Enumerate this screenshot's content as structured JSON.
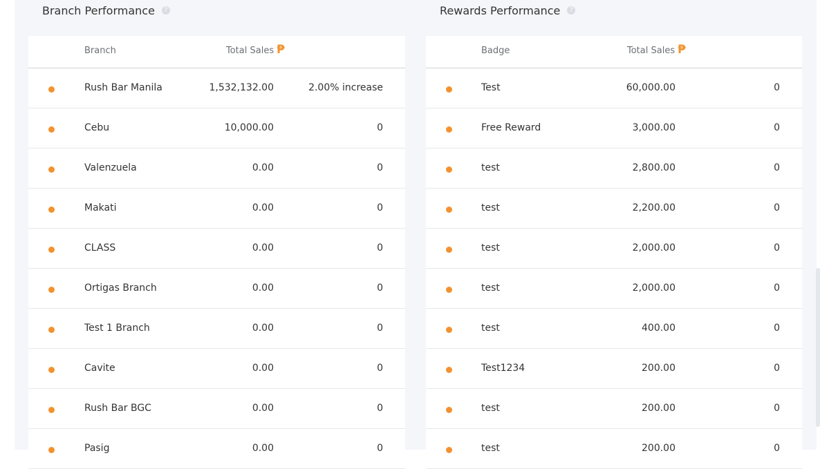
{
  "branch_performance": {
    "title": "Branch Performance",
    "col_name": "Branch",
    "col_sales": "Total Sales",
    "currency_icon": "peso-icon",
    "rows": [
      {
        "name": "Rush Bar Manila",
        "sales": "1,532,132.00",
        "change": "2.00% increase"
      },
      {
        "name": "Cebu",
        "sales": "10,000.00",
        "change": "0"
      },
      {
        "name": "Valenzuela",
        "sales": "0.00",
        "change": "0"
      },
      {
        "name": "Makati",
        "sales": "0.00",
        "change": "0"
      },
      {
        "name": "CLASS",
        "sales": "0.00",
        "change": "0"
      },
      {
        "name": "Ortigas Branch",
        "sales": "0.00",
        "change": "0"
      },
      {
        "name": "Test 1 Branch",
        "sales": "0.00",
        "change": "0"
      },
      {
        "name": "Cavite",
        "sales": "0.00",
        "change": "0"
      },
      {
        "name": "Rush Bar BGC",
        "sales": "0.00",
        "change": "0"
      },
      {
        "name": "Pasig",
        "sales": "0.00",
        "change": "0"
      }
    ]
  },
  "rewards_performance": {
    "title": "Rewards Performance",
    "col_name": "Badge",
    "col_sales": "Total Sales",
    "currency_icon": "peso-icon",
    "rows": [
      {
        "name": "Test",
        "sales": "60,000.00",
        "change": "0"
      },
      {
        "name": "Free Reward",
        "sales": "3,000.00",
        "change": "0"
      },
      {
        "name": "test",
        "sales": "2,800.00",
        "change": "0"
      },
      {
        "name": "test",
        "sales": "2,200.00",
        "change": "0"
      },
      {
        "name": "test",
        "sales": "2,000.00",
        "change": "0"
      },
      {
        "name": "test",
        "sales": "2,000.00",
        "change": "0"
      },
      {
        "name": "test",
        "sales": "400.00",
        "change": "0"
      },
      {
        "name": "Test1234",
        "sales": "200.00",
        "change": "0"
      },
      {
        "name": "test",
        "sales": "200.00",
        "change": "0"
      },
      {
        "name": "test",
        "sales": "200.00",
        "change": "0"
      }
    ]
  },
  "colors": {
    "accent": "#f2922e",
    "panel_bg": "#f4f6fa"
  }
}
